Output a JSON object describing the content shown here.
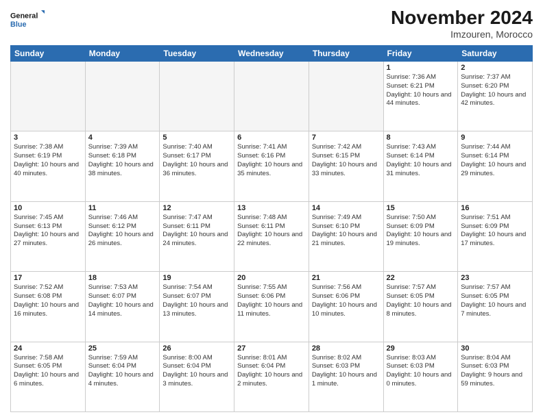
{
  "logo": {
    "text_general": "General",
    "text_blue": "Blue"
  },
  "header": {
    "month": "November 2024",
    "location": "Imzouren, Morocco"
  },
  "days_of_week": [
    "Sunday",
    "Monday",
    "Tuesday",
    "Wednesday",
    "Thursday",
    "Friday",
    "Saturday"
  ],
  "weeks": [
    [
      {
        "day": "",
        "empty": true
      },
      {
        "day": "",
        "empty": true
      },
      {
        "day": "",
        "empty": true
      },
      {
        "day": "",
        "empty": true
      },
      {
        "day": "",
        "empty": true
      },
      {
        "day": "1",
        "sunrise": "7:36 AM",
        "sunset": "6:21 PM",
        "daylight": "Daylight: 10 hours and 44 minutes."
      },
      {
        "day": "2",
        "sunrise": "7:37 AM",
        "sunset": "6:20 PM",
        "daylight": "Daylight: 10 hours and 42 minutes."
      }
    ],
    [
      {
        "day": "3",
        "sunrise": "7:38 AM",
        "sunset": "6:19 PM",
        "daylight": "Daylight: 10 hours and 40 minutes."
      },
      {
        "day": "4",
        "sunrise": "7:39 AM",
        "sunset": "6:18 PM",
        "daylight": "Daylight: 10 hours and 38 minutes."
      },
      {
        "day": "5",
        "sunrise": "7:40 AM",
        "sunset": "6:17 PM",
        "daylight": "Daylight: 10 hours and 36 minutes."
      },
      {
        "day": "6",
        "sunrise": "7:41 AM",
        "sunset": "6:16 PM",
        "daylight": "Daylight: 10 hours and 35 minutes."
      },
      {
        "day": "7",
        "sunrise": "7:42 AM",
        "sunset": "6:15 PM",
        "daylight": "Daylight: 10 hours and 33 minutes."
      },
      {
        "day": "8",
        "sunrise": "7:43 AM",
        "sunset": "6:14 PM",
        "daylight": "Daylight: 10 hours and 31 minutes."
      },
      {
        "day": "9",
        "sunrise": "7:44 AM",
        "sunset": "6:14 PM",
        "daylight": "Daylight: 10 hours and 29 minutes."
      }
    ],
    [
      {
        "day": "10",
        "sunrise": "7:45 AM",
        "sunset": "6:13 PM",
        "daylight": "Daylight: 10 hours and 27 minutes."
      },
      {
        "day": "11",
        "sunrise": "7:46 AM",
        "sunset": "6:12 PM",
        "daylight": "Daylight: 10 hours and 26 minutes."
      },
      {
        "day": "12",
        "sunrise": "7:47 AM",
        "sunset": "6:11 PM",
        "daylight": "Daylight: 10 hours and 24 minutes."
      },
      {
        "day": "13",
        "sunrise": "7:48 AM",
        "sunset": "6:11 PM",
        "daylight": "Daylight: 10 hours and 22 minutes."
      },
      {
        "day": "14",
        "sunrise": "7:49 AM",
        "sunset": "6:10 PM",
        "daylight": "Daylight: 10 hours and 21 minutes."
      },
      {
        "day": "15",
        "sunrise": "7:50 AM",
        "sunset": "6:09 PM",
        "daylight": "Daylight: 10 hours and 19 minutes."
      },
      {
        "day": "16",
        "sunrise": "7:51 AM",
        "sunset": "6:09 PM",
        "daylight": "Daylight: 10 hours and 17 minutes."
      }
    ],
    [
      {
        "day": "17",
        "sunrise": "7:52 AM",
        "sunset": "6:08 PM",
        "daylight": "Daylight: 10 hours and 16 minutes."
      },
      {
        "day": "18",
        "sunrise": "7:53 AM",
        "sunset": "6:07 PM",
        "daylight": "Daylight: 10 hours and 14 minutes."
      },
      {
        "day": "19",
        "sunrise": "7:54 AM",
        "sunset": "6:07 PM",
        "daylight": "Daylight: 10 hours and 13 minutes."
      },
      {
        "day": "20",
        "sunrise": "7:55 AM",
        "sunset": "6:06 PM",
        "daylight": "Daylight: 10 hours and 11 minutes."
      },
      {
        "day": "21",
        "sunrise": "7:56 AM",
        "sunset": "6:06 PM",
        "daylight": "Daylight: 10 hours and 10 minutes."
      },
      {
        "day": "22",
        "sunrise": "7:57 AM",
        "sunset": "6:05 PM",
        "daylight": "Daylight: 10 hours and 8 minutes."
      },
      {
        "day": "23",
        "sunrise": "7:57 AM",
        "sunset": "6:05 PM",
        "daylight": "Daylight: 10 hours and 7 minutes."
      }
    ],
    [
      {
        "day": "24",
        "sunrise": "7:58 AM",
        "sunset": "6:05 PM",
        "daylight": "Daylight: 10 hours and 6 minutes."
      },
      {
        "day": "25",
        "sunrise": "7:59 AM",
        "sunset": "6:04 PM",
        "daylight": "Daylight: 10 hours and 4 minutes."
      },
      {
        "day": "26",
        "sunrise": "8:00 AM",
        "sunset": "6:04 PM",
        "daylight": "Daylight: 10 hours and 3 minutes."
      },
      {
        "day": "27",
        "sunrise": "8:01 AM",
        "sunset": "6:04 PM",
        "daylight": "Daylight: 10 hours and 2 minutes."
      },
      {
        "day": "28",
        "sunrise": "8:02 AM",
        "sunset": "6:03 PM",
        "daylight": "Daylight: 10 hours and 1 minute."
      },
      {
        "day": "29",
        "sunrise": "8:03 AM",
        "sunset": "6:03 PM",
        "daylight": "Daylight: 10 hours and 0 minutes."
      },
      {
        "day": "30",
        "sunrise": "8:04 AM",
        "sunset": "6:03 PM",
        "daylight": "Daylight: 9 hours and 59 minutes."
      }
    ]
  ]
}
